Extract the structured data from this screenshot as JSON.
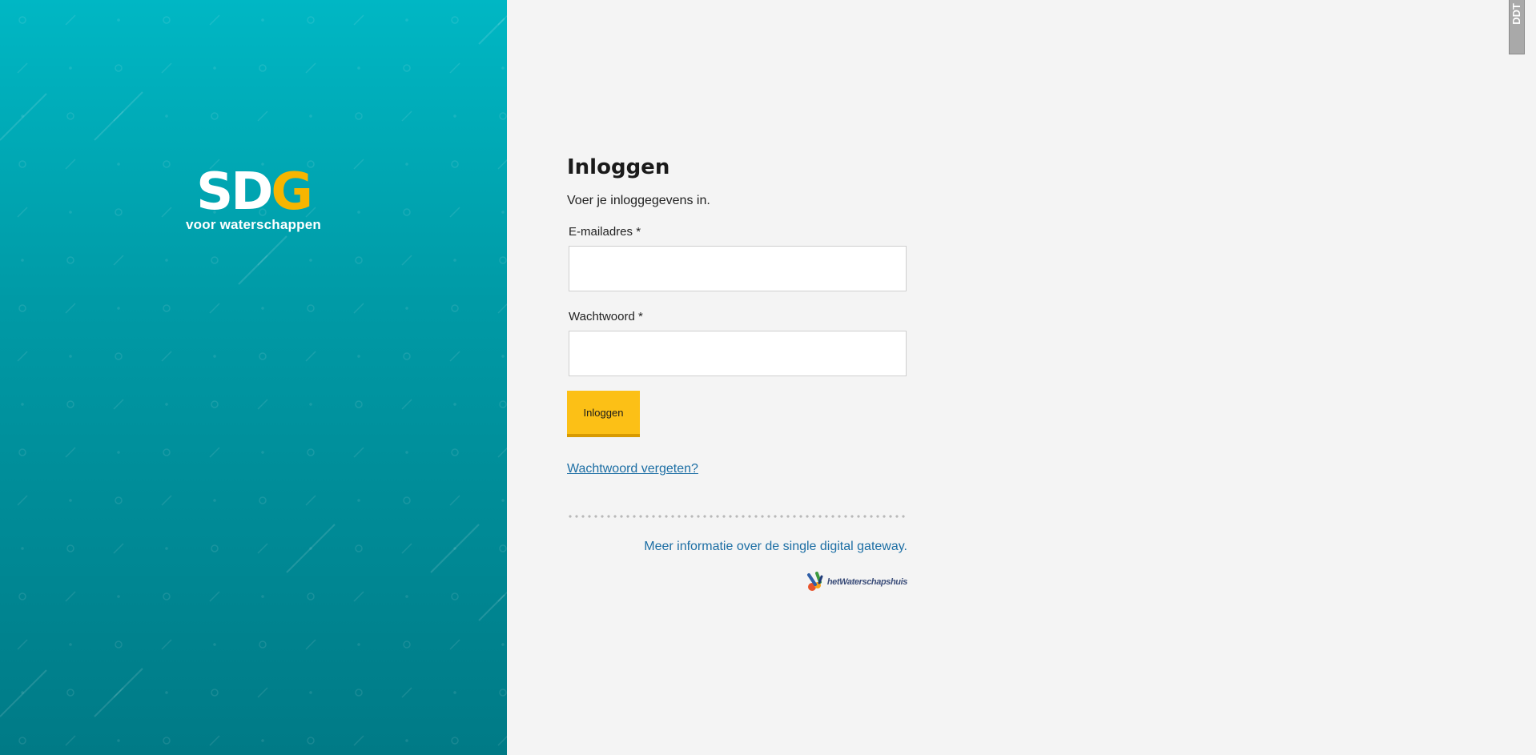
{
  "branding": {
    "logo_part1": "SD",
    "logo_part2": "G",
    "logo_subtitle": "voor waterschappen",
    "accent_yellow": "#f7b500",
    "teal_top": "#00b7c4",
    "teal_bottom": "#007a86"
  },
  "corner_widget": {
    "label": "DDT"
  },
  "login": {
    "title": "Inloggen",
    "subtitle": "Voer je inloggegevens in.",
    "email_label": "E-mailadres *",
    "email_value": "",
    "password_label": "Wachtwoord *",
    "password_value": "",
    "submit_label": "Inloggen",
    "forgot_password": "Wachtwoord vergeten?"
  },
  "footer": {
    "info_link": "Meer informatie over de single digital gateway.",
    "partner_name": "hetWaterschapshuis",
    "link_color": "#1c6ea4"
  }
}
